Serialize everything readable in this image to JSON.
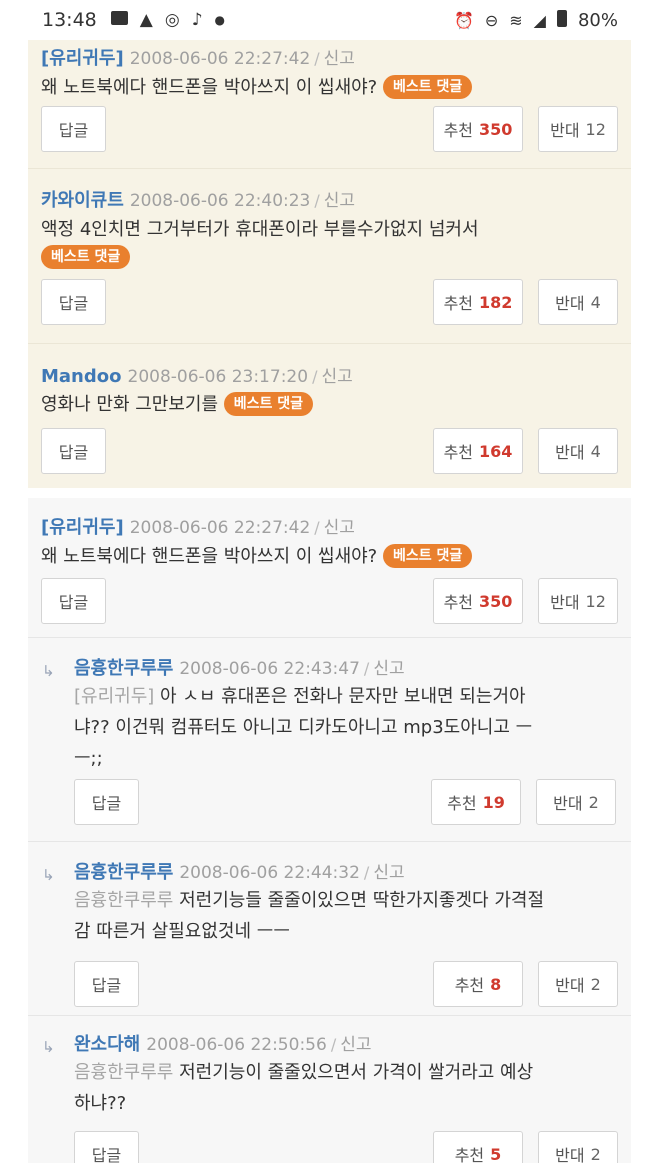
{
  "status_bar": {
    "time": "13:48",
    "battery": "80%",
    "left_icons": [
      "image-icon",
      "warning-icon",
      "instagram-icon",
      "notification-bell-icon",
      "dot-icon"
    ],
    "right_icons": [
      "alarm-icon",
      "do-not-disturb-icon",
      "wifi-icon",
      "signal-icon",
      "battery-icon"
    ]
  },
  "labels": {
    "reply_button": "답글",
    "like_label": "추천",
    "dislike_label": "반대",
    "best_badge": "베스트 댓글",
    "report": "신고",
    "separator": "/"
  },
  "colors": {
    "author": "#3f78b5",
    "best_badge": "#e9802e",
    "like_count": "#d03a2e",
    "best_bg": "#f7f3e6"
  },
  "best_comments": [
    {
      "author": "[유리귀두]",
      "date": "2008-06-06 22:27:42",
      "text": "왜 노트북에다 핸드폰을 박아쓰지 이 씹새야?",
      "likes": "350",
      "dislikes": "12"
    },
    {
      "author": "카와이큐트",
      "date": "2008-06-06 22:40:23",
      "text": "액정 4인치면 그거부터가 휴대폰이라 부를수가없지 넘커서",
      "likes": "182",
      "dislikes": "4"
    },
    {
      "author": "Mandoo",
      "date": "2008-06-06 23:17:20",
      "text": "영화나 만화 그만보기를",
      "likes": "164",
      "dislikes": "4"
    }
  ],
  "comments": [
    {
      "author": "[유리귀두]",
      "date": "2008-06-06 22:27:42",
      "text": "왜 노트북에다 핸드폰을 박아쓰지 이 씹새야?",
      "likes": "350",
      "dislikes": "12"
    },
    {
      "author": "음흉한쿠루루",
      "date": "2008-06-06 22:43:47",
      "mention": "[유리귀두]",
      "text_line1": "아 ㅅㅂ 휴대폰은 전화나 문자만 보내면 되는거아",
      "text_line2": "냐?? 이건뭐 컴퓨터도 아니고 디카도아니고 mp3도아니고 ㅡ",
      "text_line3": "ㅡ;;",
      "likes": "19",
      "dislikes": "2"
    },
    {
      "author": "음흉한쿠루루",
      "date": "2008-06-06 22:44:32",
      "mention": "음흉한쿠루루",
      "text_line1": "저런기능들 줄줄이있으면 딱한가지좋겟다 가격절",
      "text_line2": "감 따른거 살필요없것네 ㅡㅡ",
      "likes": "8",
      "dislikes": "2"
    },
    {
      "author": "완소다해",
      "date": "2008-06-06 22:50:56",
      "mention": "음흉한쿠루루",
      "text_line1": "저런기능이 줄줄있으면서 가격이 쌀거라고 예상",
      "text_line2": "하냐??",
      "likes": "5",
      "dislikes": "2"
    }
  ]
}
